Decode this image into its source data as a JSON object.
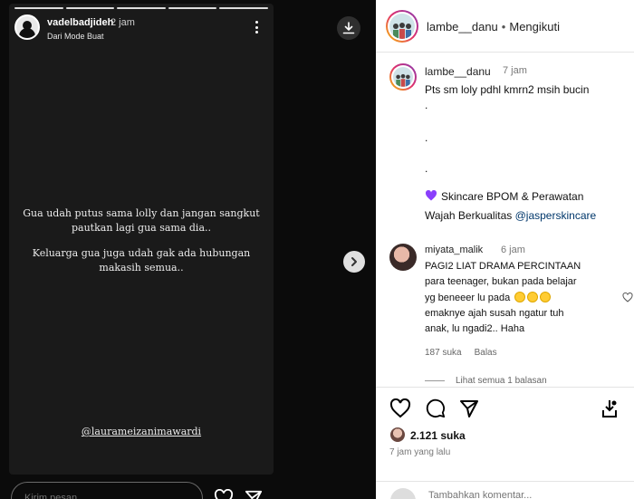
{
  "story": {
    "username": "vadelbadjideh",
    "time": "2 jam",
    "subtitle": "Dari Mode Buat",
    "text_lines": [
      "Gua udah putus sama lolly dan jangan sangkut",
      "pautkan lagi gua sama dia..",
      "Keluarga gua juga udah gak ada hubungan",
      "makasih semua.."
    ],
    "mention": "@laurameizanimawardi",
    "reply_placeholder": "Kirim pesan..."
  },
  "post": {
    "header": {
      "username": "lambe__danu",
      "separator": "•",
      "follow_status": "Mengikuti"
    },
    "caption": {
      "username": "lambe__danu",
      "time": "7 jam",
      "line1": "Pts sm loly pdhl kmrn2 msih bucin",
      "dots": [
        ".",
        ".",
        "."
      ],
      "promo_line1": "Skincare BPOM & Perawatan",
      "promo_line2_prefix": "Wajah Berkualitas ",
      "promo_link": "@jasperskincare"
    },
    "comment": {
      "username": "miyata_malik",
      "time": "6 jam",
      "lines": [
        "PAGI2 LIAT DRAMA PERCINTAAN",
        "para teenager, bukan pada belajar",
        "yg beneeer lu pada",
        "emaknye ajah susah ngatur tuh",
        "anak, lu ngadi2.. Haha"
      ],
      "likes": "187 suka",
      "reply_label": "Balas",
      "view_replies": "Lihat semua 1 balasan"
    },
    "likes_count": "2.121 suka",
    "date": "7 jam yang lalu",
    "add_comment_placeholder": "Tambahkan komentar..."
  },
  "colors": {
    "link": "#00376b",
    "ring_gradient": [
      "#f9c400",
      "#e1306c",
      "#833ab4"
    ],
    "purple_heart": "#8a3ffc"
  },
  "icons": [
    "download-icon",
    "chevron-right-icon",
    "more-icon",
    "heart-icon",
    "comment-icon",
    "send-icon",
    "save-icon",
    "purple-heart-icon"
  ]
}
